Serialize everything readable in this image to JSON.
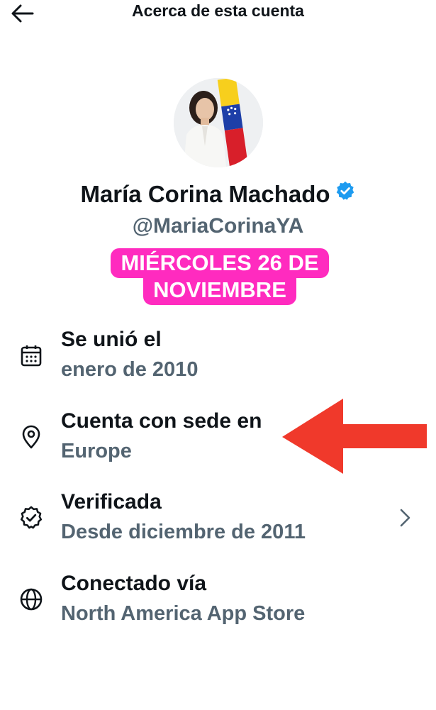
{
  "header": {
    "title": "Acerca de esta cuenta",
    "back_icon": "arrow-left-icon"
  },
  "profile": {
    "name": "María Corina Machado",
    "handle": "@MariaCorinaYA",
    "verified_badge_color": "#1d9bf0"
  },
  "stamp": {
    "line1": "MIÉRCOLES 26 DE",
    "line2": "NOVIEMBRE",
    "color": "#ff2bbf"
  },
  "rows": [
    {
      "icon": "calendar-icon",
      "title": "Se unió el",
      "value": "enero de 2010"
    },
    {
      "icon": "location-pin-icon",
      "title": "Cuenta con sede en",
      "value": "Europe"
    },
    {
      "icon": "verified-check-icon",
      "title": "Verificada",
      "value": "Desde diciembre de 2011"
    },
    {
      "icon": "globe-icon",
      "title": "Conectado vía",
      "value": "North America App Store"
    }
  ],
  "annotation": {
    "arrow_color": "#f0392b"
  }
}
